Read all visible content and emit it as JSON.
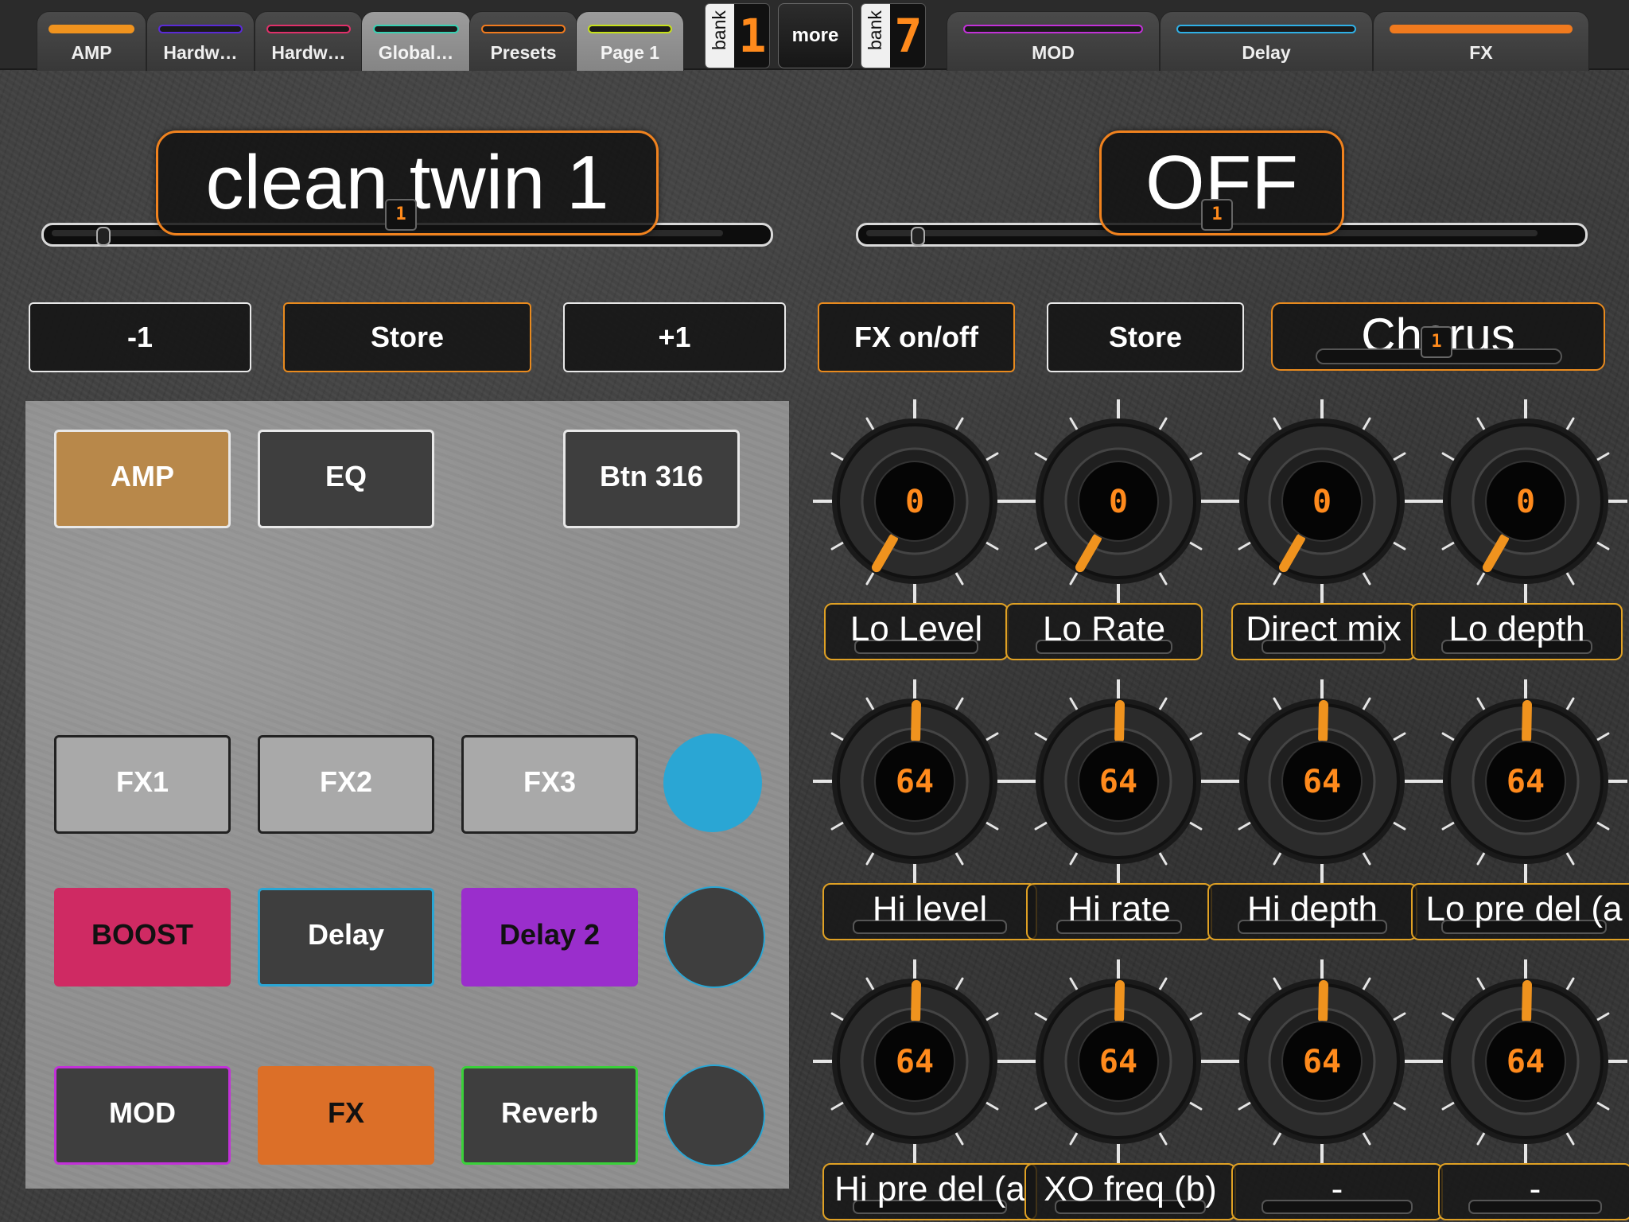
{
  "tabs": [
    {
      "label": "AMP",
      "color": "#f0931e",
      "solid": true,
      "active": true
    },
    {
      "label": "Hardw…",
      "color": "#5a2ad6",
      "solid": false
    },
    {
      "label": "Hardw…",
      "color": "#e0306a",
      "solid": false
    },
    {
      "label": "Global…",
      "color": "#39d0b2",
      "solid": false,
      "light": true
    },
    {
      "label": "Presets",
      "color": "#f07a1e",
      "solid": false
    },
    {
      "label": "Page 1",
      "color": "#c6e01a",
      "solid": false,
      "light": true
    },
    {
      "label": "MOD",
      "color": "#c231d8",
      "solid": false
    },
    {
      "label": "Delay",
      "color": "#2fb0e6",
      "solid": false
    },
    {
      "label": "FX",
      "color": "#f07a1e",
      "solid": true,
      "active": true
    }
  ],
  "bank_left": {
    "label": "bank",
    "value": "1"
  },
  "more_label": "more",
  "bank_right": {
    "label": "bank",
    "value": "7"
  },
  "preset": {
    "name": "clean twin 1",
    "led": "1"
  },
  "fx_state": {
    "value": "OFF",
    "led": "1"
  },
  "buttons": {
    "minus": "-1",
    "store_left": "Store",
    "plus": "+1",
    "fx_onoff": "FX on/off",
    "store_right": "Store",
    "chorus": "Chorus",
    "chorus_led": "1"
  },
  "panel": {
    "amp": "AMP",
    "eq": "EQ",
    "btn316": "Btn 316",
    "fx1": "FX1",
    "fx2": "FX2",
    "fx3": "FX3",
    "boost": "BOOST",
    "delay": "Delay",
    "delay2": "Delay 2",
    "mod": "MOD",
    "fx": "FX",
    "reverb": "Reverb"
  },
  "colors": {
    "accent": "#f0821e",
    "amp": "#b8884a",
    "boost": "#cf2a63",
    "delay2": "#9a2ecc",
    "fx": "#dc6f28",
    "cyan": "#2aa6d4",
    "label_border": "#e0a124"
  },
  "knobs": [
    {
      "value": "0",
      "label": "Lo Level"
    },
    {
      "value": "0",
      "label": "Lo Rate"
    },
    {
      "value": "0",
      "label": "Direct mix"
    },
    {
      "value": "0",
      "label": "Lo depth"
    },
    {
      "value": "64",
      "label": "Hi level"
    },
    {
      "value": "64",
      "label": "Hi rate"
    },
    {
      "value": "64",
      "label": "Hi depth"
    },
    {
      "value": "64",
      "label": "Lo pre del (a"
    },
    {
      "value": "64",
      "label": "Hi pre del (a"
    },
    {
      "value": "64",
      "label": "XO freq (b)"
    },
    {
      "value": "64",
      "label": "-"
    },
    {
      "value": "64",
      "label": "-"
    }
  ]
}
